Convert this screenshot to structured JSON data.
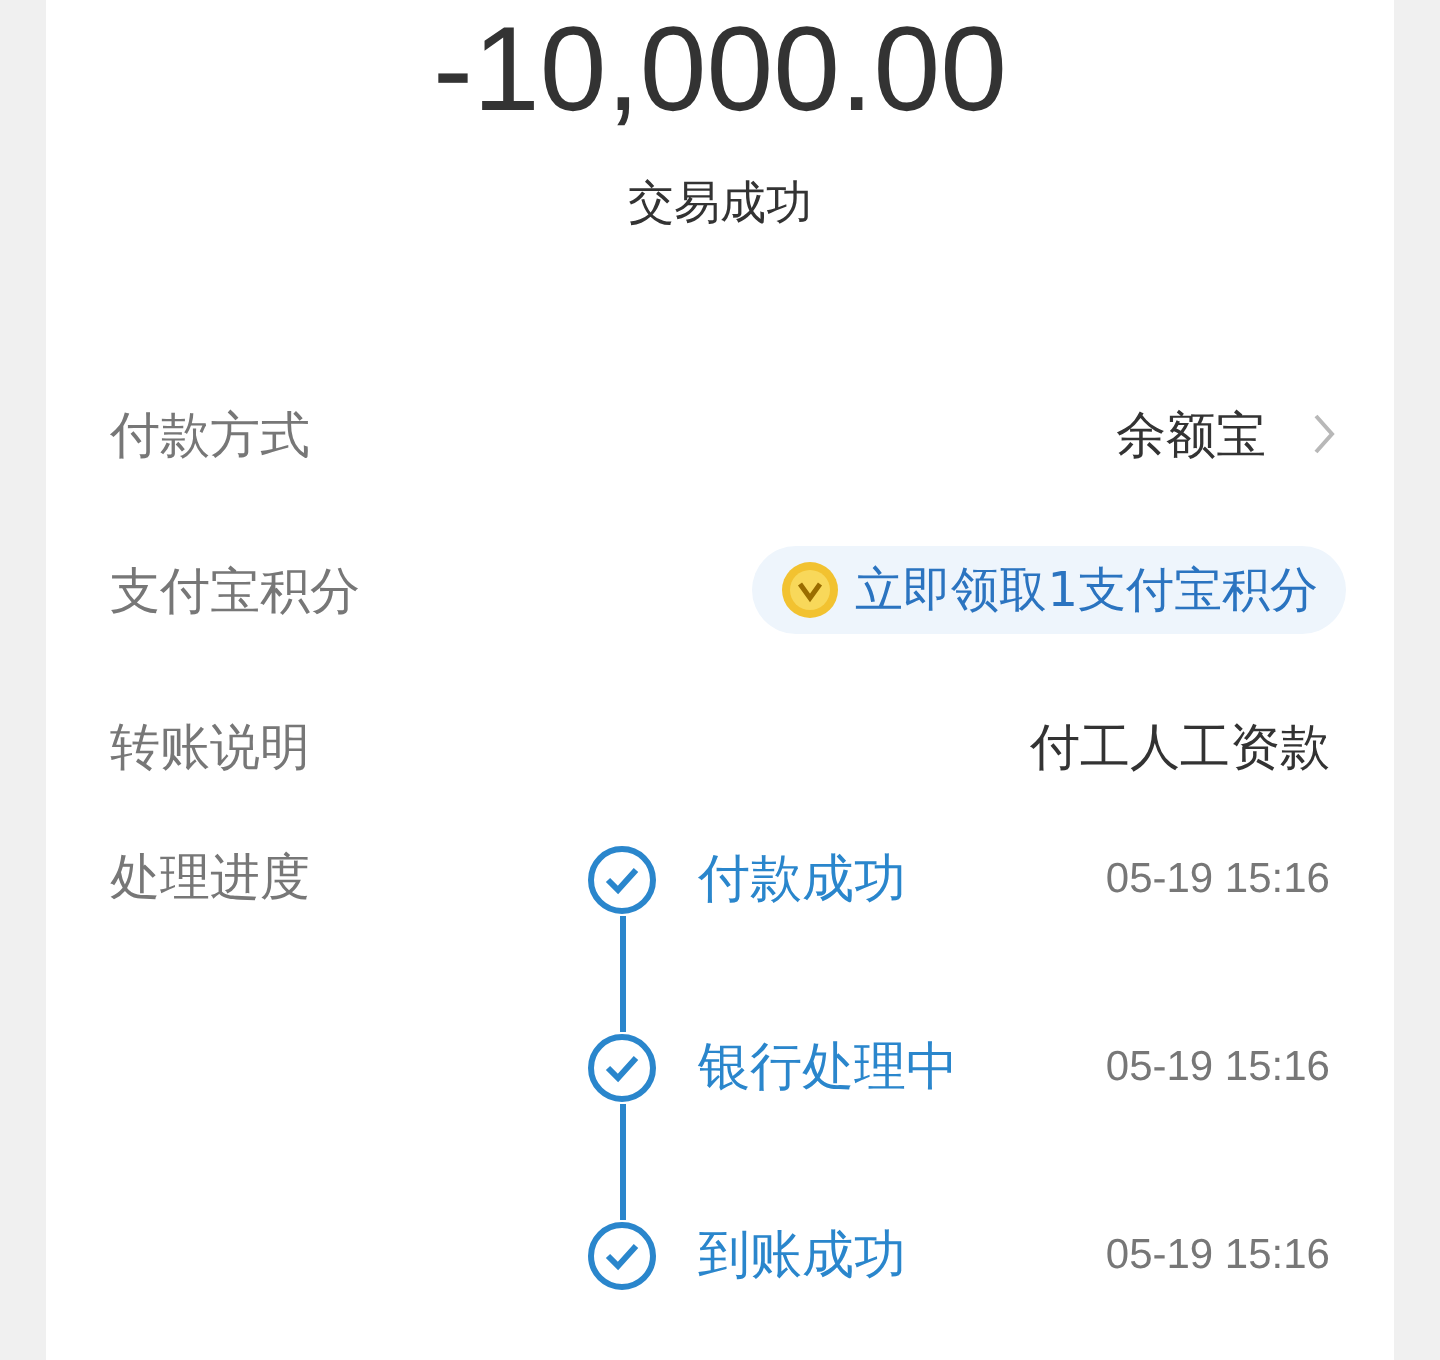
{
  "amount": "-10,000.00",
  "status": "交易成功",
  "rows": [
    {
      "kind": "link",
      "label": "付款方式",
      "value": "余额宝"
    },
    {
      "kind": "badge",
      "label": "支付宝积分",
      "value": "立即领取1支付宝积分"
    },
    {
      "kind": "text",
      "label": "转账说明",
      "value": "付工人工资款"
    },
    {
      "kind": "timeline",
      "label": "处理进度",
      "steps": [
        {
          "title": "付款成功",
          "time": "05-19 15:16"
        },
        {
          "title": "银行处理中",
          "time": "05-19 15:16"
        },
        {
          "title": "到账成功",
          "time": "05-19 15:16"
        }
      ]
    }
  ]
}
